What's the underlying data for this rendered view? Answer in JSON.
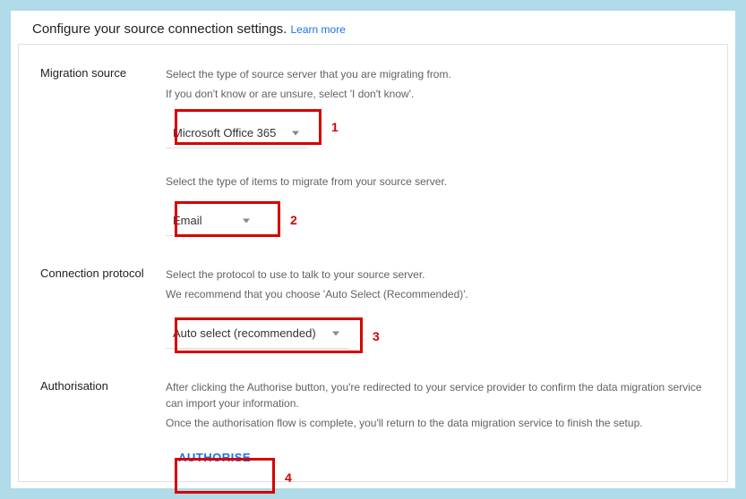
{
  "header": {
    "title": "Configure your source connection settings.",
    "learn_more": "Learn more"
  },
  "sections": {
    "migration_source": {
      "label": "Migration source",
      "help1": "Select the type of source server that you are migrating from.",
      "help2": "If you don't know or are unsure, select 'I don't know'.",
      "dropdown_value": "Microsoft Office 365",
      "help3": "Select the type of items to migrate from your source server.",
      "items_dropdown_value": "Email"
    },
    "connection_protocol": {
      "label": "Connection protocol",
      "help1": "Select the protocol to use to talk to your source server.",
      "help2": "We recommend that you choose 'Auto Select (Recommended)'.",
      "dropdown_value": "Auto select (recommended)"
    },
    "authorisation": {
      "label": "Authorisation",
      "help1": "After clicking the Authorise button, you're redirected to your service provider to confirm the data migration service can import your information.",
      "help2": "Once the authorisation flow is complete, you'll return to the data migration service to finish the setup.",
      "button_label": "AUTHORISE"
    }
  },
  "annotations": {
    "a1": "1",
    "a2": "2",
    "a3": "3",
    "a4": "4"
  }
}
